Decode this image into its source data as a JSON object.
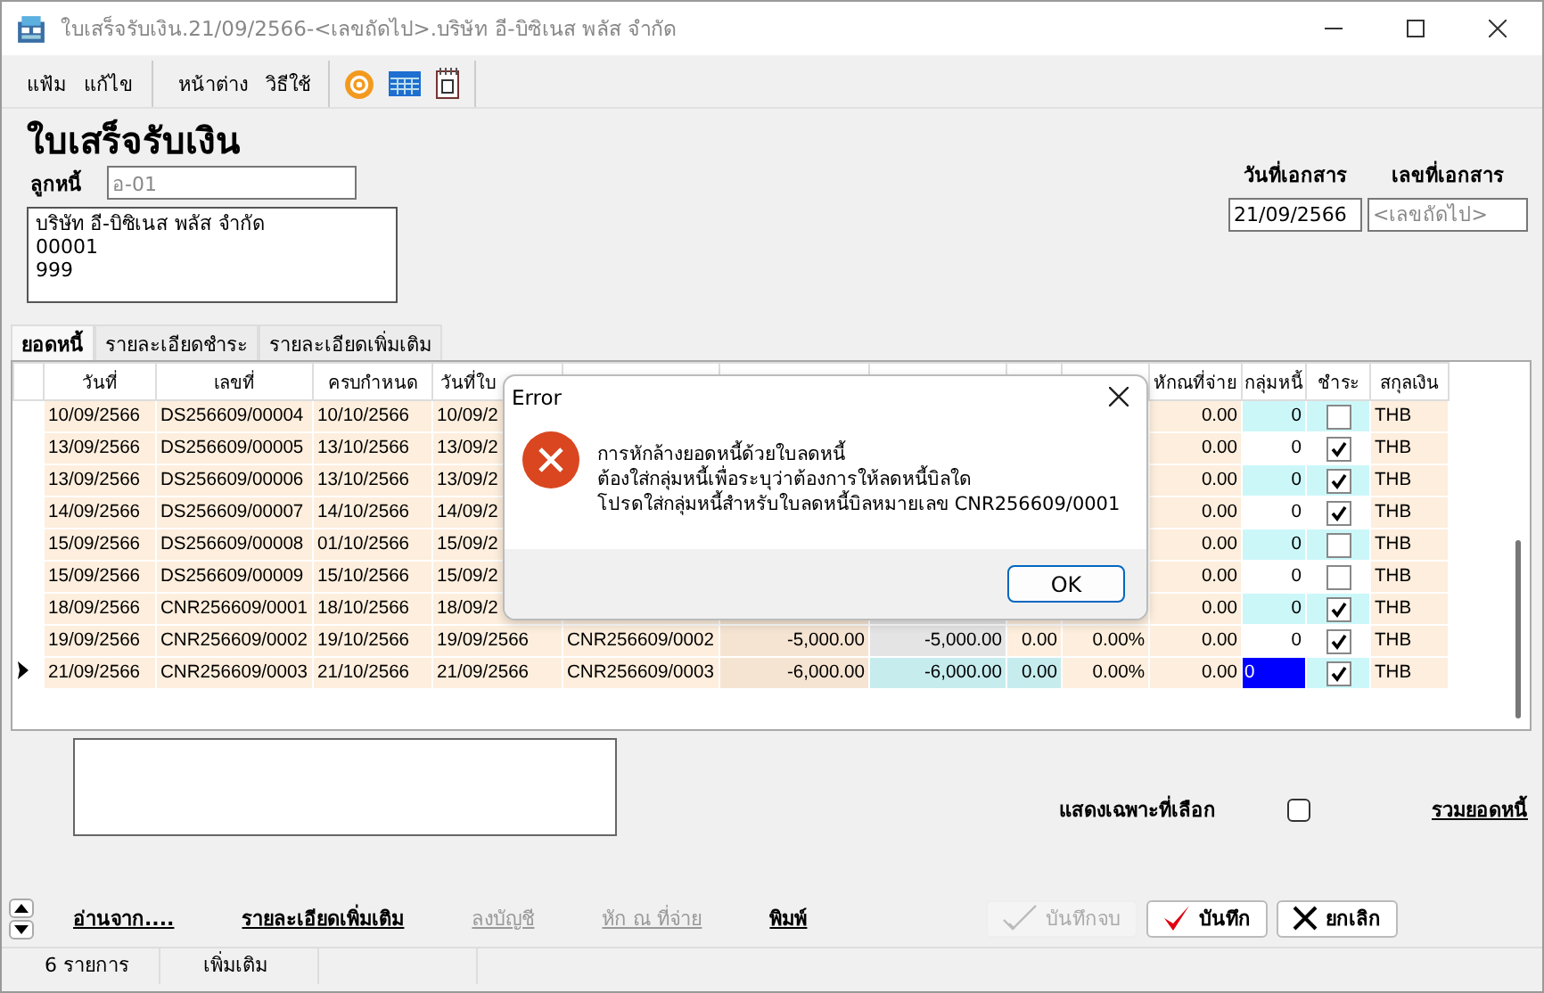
{
  "window": {
    "title": "ใบเสร็จรับเงิน.21/09/2566-<เลขถัดไป>.บริษัท อี-บิซิเนส พลัส จำกัด"
  },
  "menu_groups": [
    [
      "แฟ้ม",
      "แก้ไข"
    ],
    [
      "หน้าต่าง",
      "วิธีใช้"
    ]
  ],
  "form": {
    "heading": "ใบเสร็จรับเงิน",
    "debtor_label": "ลูกหนี้",
    "debtor_code": "อ-01",
    "address_lines": [
      "บริษัท อี-บิซิเนส พลัส จำกัด",
      "00001",
      "999"
    ],
    "doc_date_label": "วันที่เอกสาร",
    "doc_date": "21/09/2566",
    "doc_no_label": "เลขที่เอกสาร",
    "doc_no_placeholder": "<เลขถัดไป>"
  },
  "tabs": [
    {
      "label": "ยอดหนี้",
      "selected": true
    },
    {
      "label": "รายละเอียดชำระ",
      "selected": false
    },
    {
      "label": "รายละเอียดเพิ่มเติม",
      "selected": false
    }
  ],
  "table": {
    "header_left": [
      "วันที่",
      "เลขที่",
      "ครบกำหนด",
      "วันที่ใบ"
    ],
    "header_right": [
      "หักณที่จ่าย",
      "กลุ่มหนี้",
      "ชำระ",
      "สกุลเงิน"
    ],
    "rows": [
      {
        "current": false,
        "date": "10/09/2566",
        "number": "DS256609/00004",
        "due": "10/10/2566",
        "invoice_date": "10/09/2",
        "withholding": "0.00",
        "group": "0",
        "paid": false,
        "currency": "THB"
      },
      {
        "current": false,
        "date": "13/09/2566",
        "number": "DS256609/00005",
        "due": "13/10/2566",
        "invoice_date": "13/09/2",
        "withholding": "0.00",
        "group": "0",
        "paid": true,
        "currency": "THB"
      },
      {
        "current": false,
        "date": "13/09/2566",
        "number": "DS256609/00006",
        "due": "13/10/2566",
        "invoice_date": "13/09/2",
        "withholding": "0.00",
        "group": "0",
        "paid": true,
        "currency": "THB"
      },
      {
        "current": false,
        "date": "14/09/2566",
        "number": "DS256609/00007",
        "due": "14/10/2566",
        "invoice_date": "14/09/2",
        "withholding": "0.00",
        "group": "0",
        "paid": true,
        "currency": "THB"
      },
      {
        "current": false,
        "date": "15/09/2566",
        "number": "DS256609/00008",
        "due": "01/10/2566",
        "invoice_date": "15/09/2",
        "withholding": "0.00",
        "group": "0",
        "paid": false,
        "currency": "THB"
      },
      {
        "current": false,
        "date": "15/09/2566",
        "number": "DS256609/00009",
        "due": "15/10/2566",
        "invoice_date": "15/09/2",
        "withholding": "0.00",
        "group": "0",
        "paid": false,
        "currency": "THB"
      },
      {
        "current": false,
        "date": "18/09/2566",
        "number": "CNR256609/0001",
        "due": "18/10/2566",
        "invoice_date": "18/09/2",
        "withholding": "0.00",
        "group": "0",
        "paid": true,
        "currency": "THB"
      },
      {
        "current": false,
        "date": "19/09/2566",
        "number": "CNR256609/0002",
        "due": "19/10/2566",
        "invoice_date": "19/09/2566",
        "ref": "CNR256609/0002",
        "amount": "-5,000.00",
        "balance": "-5,000.00",
        "discount": "0.00",
        "percent": "0.00%",
        "withholding": "0.00",
        "group": "0",
        "paid": true,
        "currency": "THB"
      },
      {
        "current": true,
        "date": "21/09/2566",
        "number": "CNR256609/0003",
        "due": "21/10/2566",
        "invoice_date": "21/09/2566",
        "ref": "CNR256609/0003",
        "amount": "-6,000.00",
        "balance": "-6,000.00",
        "discount": "0.00",
        "percent": "0.00%",
        "withholding": "0.00",
        "group": "0",
        "paid": true,
        "currency": "THB"
      }
    ]
  },
  "filter": {
    "label": "แสดงเฉพาะที่เลือก",
    "checked": false
  },
  "total_link": "รวมยอดหนี้",
  "links": [
    {
      "label": "อ่านจาก....",
      "disabled": false
    },
    {
      "label": "รายละเอียดเพิ่มเติม",
      "disabled": false
    },
    {
      "label": "ลงบัญชี",
      "disabled": true
    },
    {
      "label": "หัก ณ ที่จ่าย",
      "disabled": true
    },
    {
      "label": "พิมพ์",
      "disabled": false
    }
  ],
  "buttons": [
    {
      "label": "บันทึกจบ",
      "kind": "save-close",
      "disabled": true
    },
    {
      "label": "บันทึก",
      "kind": "save",
      "disabled": false
    },
    {
      "label": "ยกเลิก",
      "kind": "cancel",
      "disabled": false
    }
  ],
  "status_bar": [
    "6 รายการ",
    "เพิ่มเติม"
  ],
  "dialog": {
    "title": "Error",
    "message_lines": [
      "การหักล้างยอดหนี้ด้วยใบลดหนี้",
      "ต้องใส่กลุ่มหนี้เพื่อระบุว่าต้องการให้ลดหนี้บิลใด",
      "โปรดใส่กลุ่มหนี้สำหรับใบลดหนี้บิลหมายเลข CNR256609/0001"
    ],
    "button": "OK"
  }
}
